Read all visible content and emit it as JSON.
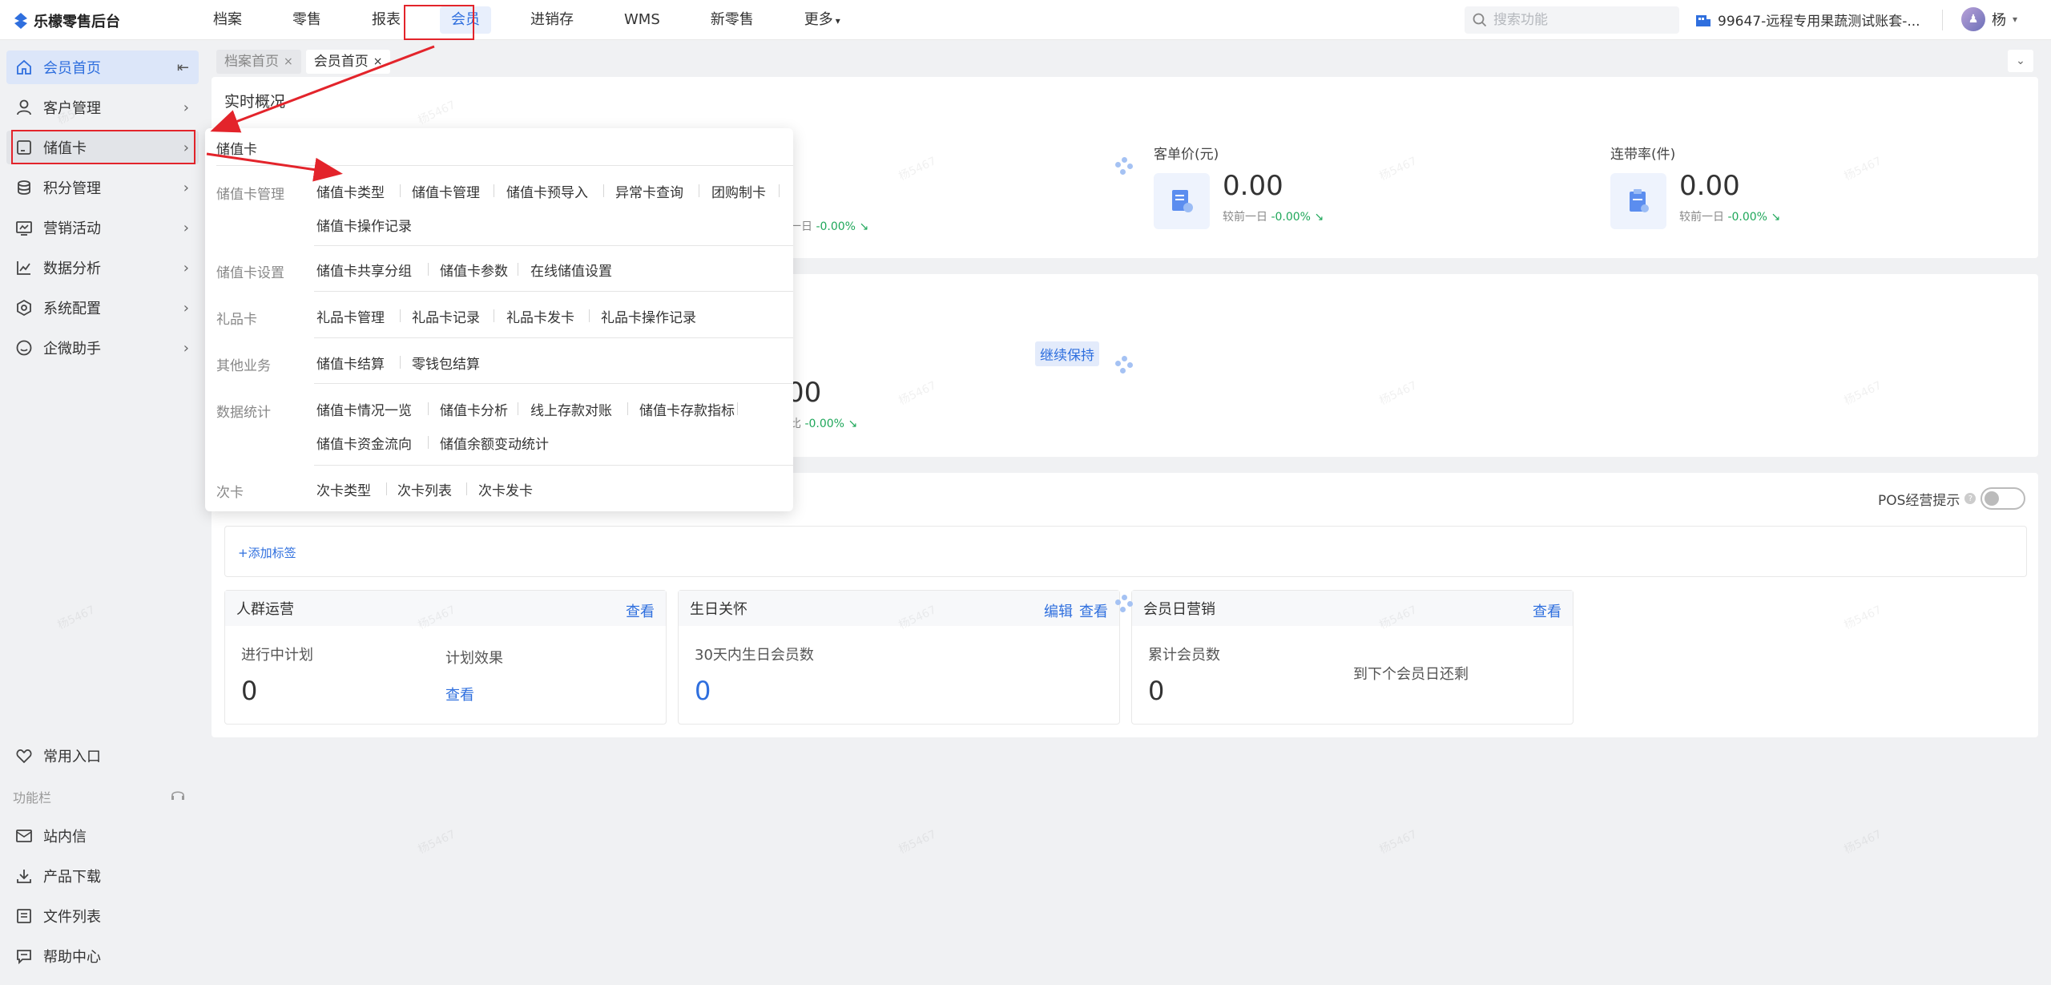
{
  "app": {
    "title": "乐檬零售后台"
  },
  "nav": {
    "items": [
      "档案",
      "零售",
      "报表",
      "会员",
      "进销存",
      "WMS",
      "新零售",
      "更多"
    ],
    "active": "会员"
  },
  "search": {
    "placeholder": "搜索功能"
  },
  "account": {
    "name": "99647-远程专用果蔬测试账套-..."
  },
  "user": {
    "name": "杨"
  },
  "sidebar": {
    "items": [
      {
        "label": "会员首页",
        "icon": "home-icon"
      },
      {
        "label": "客户管理",
        "icon": "user-icon"
      },
      {
        "label": "储值卡",
        "icon": "card-icon"
      },
      {
        "label": "积分管理",
        "icon": "coins-icon"
      },
      {
        "label": "营销活动",
        "icon": "campaign-icon"
      },
      {
        "label": "数据分析",
        "icon": "chart-icon"
      },
      {
        "label": "系统配置",
        "icon": "settings-icon"
      },
      {
        "label": "企微助手",
        "icon": "chat-icon"
      }
    ],
    "bottom": [
      {
        "label": "常用入口",
        "icon": "heart-icon"
      },
      {
        "label": "站内信",
        "icon": "mail-icon"
      },
      {
        "label": "产品下载",
        "icon": "download-icon"
      },
      {
        "label": "文件列表",
        "icon": "file-icon"
      },
      {
        "label": "帮助中心",
        "icon": "help-icon"
      }
    ],
    "section_label": "功能栏"
  },
  "tabs": [
    {
      "label": "档案首页",
      "close": "×"
    },
    {
      "label": "会员首页",
      "close": "×"
    }
  ],
  "overview": {
    "title": "实时概况",
    "metrics": [
      {
        "label": "客单价(元)",
        "value": "0.00",
        "compare": "较前一日",
        "change": "-0.00%"
      },
      {
        "label": "连带率(件)",
        "value": "0.00",
        "compare": "较前一日",
        "change": "-0.00%"
      }
    ],
    "partial_compare_prefix": "一日",
    "partial_change": "-0.00%"
  },
  "section2": {
    "badge": "继续保持",
    "partial_value": "00",
    "partial_compare_prefix": "比",
    "partial_change": "-0.00%"
  },
  "section3": {
    "pos_tip": "POS经营提示",
    "add_tag": "+添加标签",
    "panels": [
      {
        "title": "人群运营",
        "links": [
          "查看"
        ],
        "label1": "进行中计划",
        "value1": "0",
        "label2": "计划效果",
        "link2": "查看"
      },
      {
        "title": "生日关怀",
        "links": [
          "编辑",
          "查看"
        ],
        "label1": "30天内生日会员数",
        "value1": "0"
      },
      {
        "title": "会员日营销",
        "links": [
          "查看"
        ],
        "label1": "累计会员数",
        "value1": "0",
        "label2": "到下个会员日还剩"
      }
    ]
  },
  "popup": {
    "title": "储值卡",
    "groups": [
      {
        "category": "储值卡管理",
        "links": [
          "储值卡类型",
          "储值卡管理",
          "储值卡预导入",
          "异常卡查询",
          "团购制卡",
          "储值卡操作记录"
        ]
      },
      {
        "category": "储值卡设置",
        "links": [
          "储值卡共享分组",
          "储值卡参数",
          "在线储值设置"
        ]
      },
      {
        "category": "礼品卡",
        "links": [
          "礼品卡管理",
          "礼品卡记录",
          "礼品卡发卡",
          "礼品卡操作记录"
        ]
      },
      {
        "category": "其他业务",
        "links": [
          "储值卡结算",
          "零钱包结算"
        ]
      },
      {
        "category": "数据统计",
        "links": [
          "储值卡情况一览",
          "储值卡分析",
          "线上存款对账",
          "储值卡存款指标",
          "储值卡资金流向",
          "储值余额变动统计"
        ]
      },
      {
        "category": "次卡",
        "links": [
          "次卡类型",
          "次卡列表",
          "次卡发卡"
        ]
      }
    ]
  },
  "colors": {
    "accent": "#2f6fde",
    "highlight": "#e3242b",
    "positive": "#1fa75a"
  },
  "watermark": "杨5467"
}
